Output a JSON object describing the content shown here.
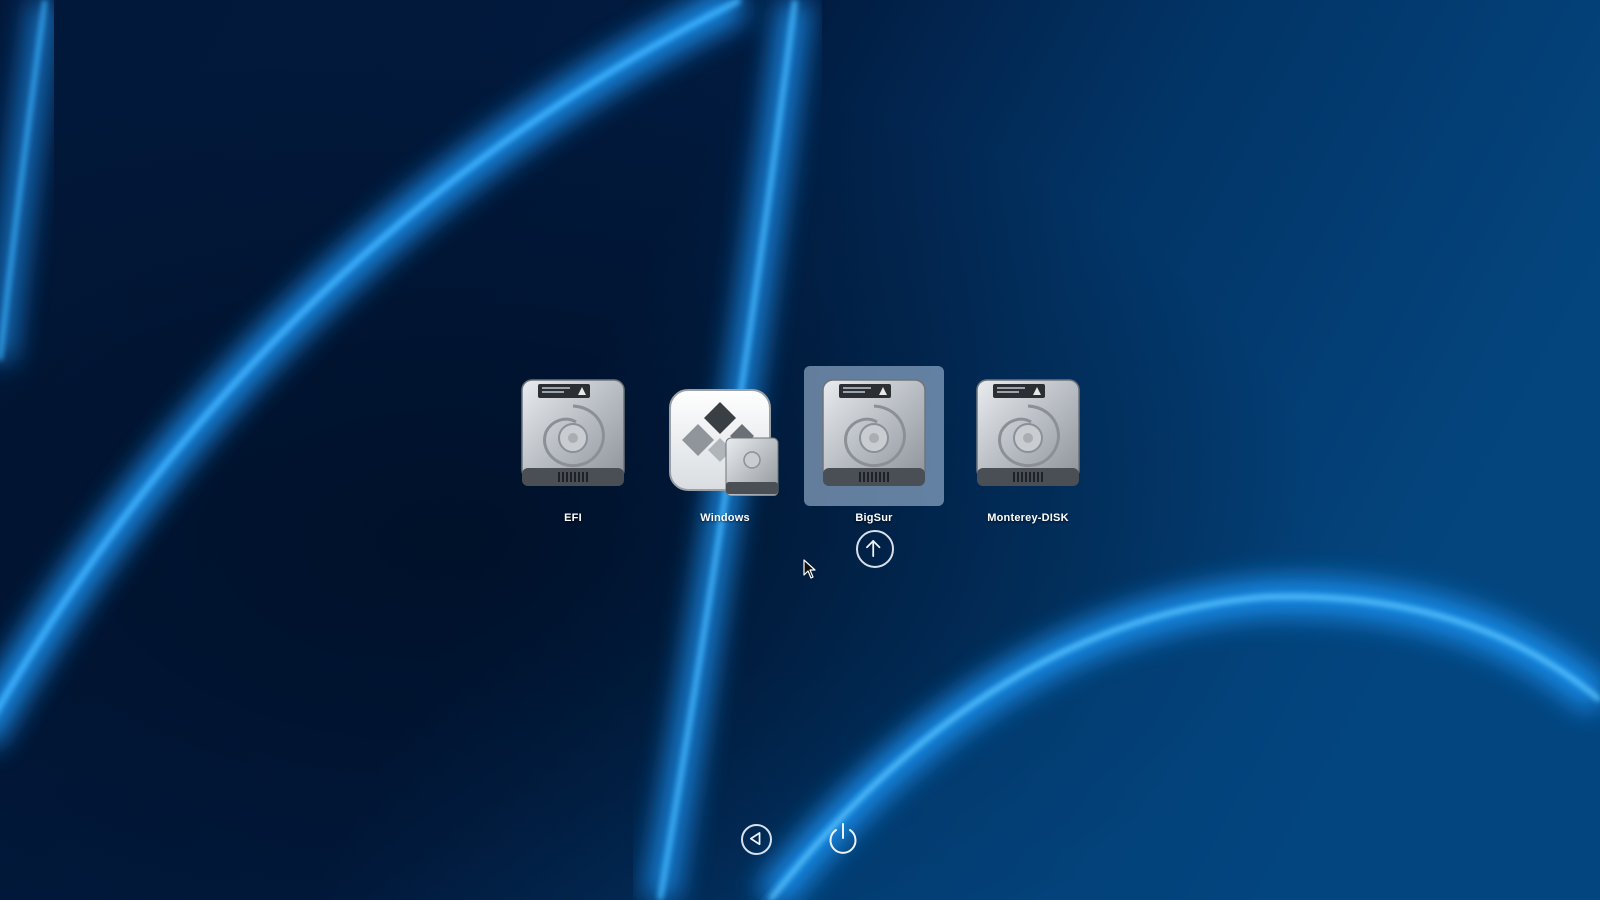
{
  "boot_entries": [
    {
      "label": "EFI",
      "icon": "hard-drive-icon",
      "selected": false
    },
    {
      "label": "Windows",
      "icon": "bootcamp-windows-icon",
      "selected": false
    },
    {
      "label": "BigSur",
      "icon": "hard-drive-icon",
      "selected": true
    },
    {
      "label": "Monterey-DISK",
      "icon": "hard-drive-icon",
      "selected": false
    }
  ],
  "controls": {
    "boot_arrow_icon": "arrow-up-circle-icon",
    "back_icon": "back-arrow-icon",
    "power_icon": "power-icon"
  },
  "colors": {
    "background": "#00234d",
    "glow": "#1e9bff",
    "selection": "#a0b9d7",
    "label": "#ffffff"
  }
}
